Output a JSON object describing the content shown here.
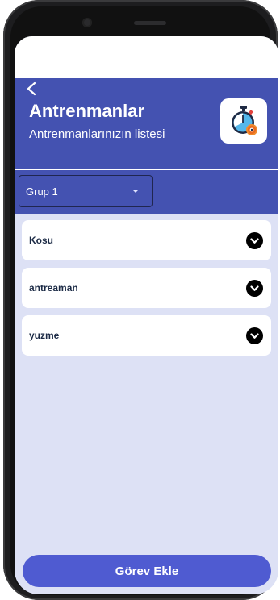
{
  "header": {
    "back_icon": "chevron-left-icon",
    "title": "Antrenmanlar",
    "subtitle": "Antrenmanlarınızın listesi",
    "app_icon": "stopwatch-gear-icon"
  },
  "filter": {
    "selected": "Grup 1",
    "icon": "caret-down-icon"
  },
  "trainings": [
    {
      "label": "Kosu",
      "icon": "chevron-down-circle-icon"
    },
    {
      "label": "antreaman",
      "icon": "chevron-down-circle-icon"
    },
    {
      "label": "yuzme",
      "icon": "chevron-down-circle-icon"
    }
  ],
  "footer": {
    "add_button": "Görev Ekle"
  },
  "colors": {
    "header_bg": "#4452b1",
    "screen_bg": "#dde1f5",
    "button_bg": "#4f5bd1",
    "label_text": "#1b2a45"
  }
}
